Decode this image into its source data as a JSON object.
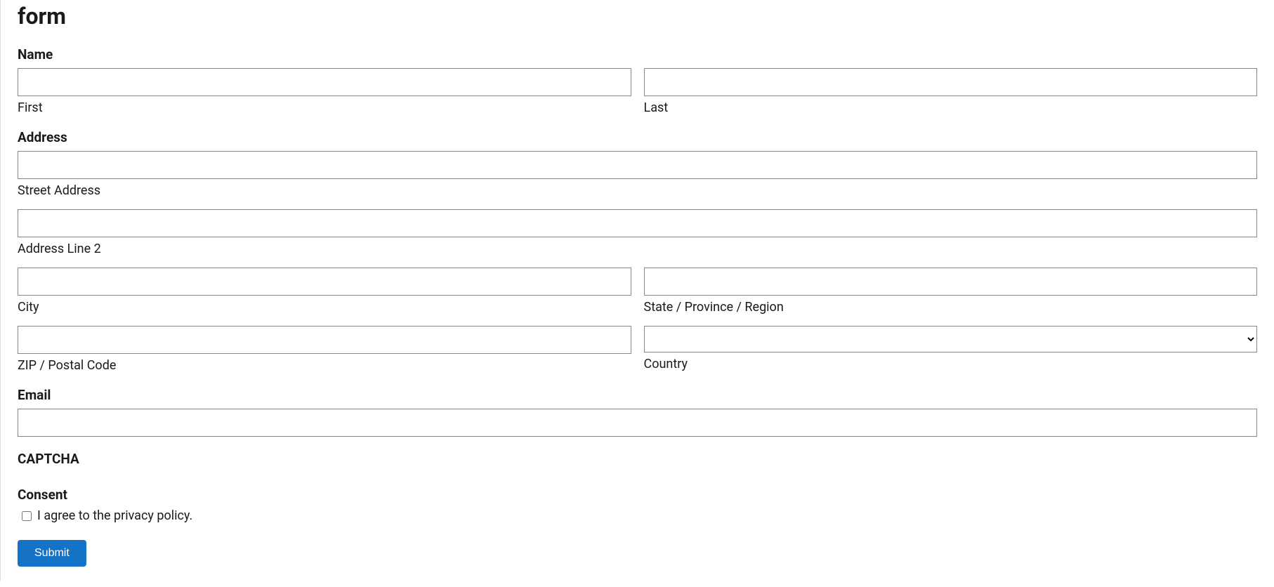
{
  "form": {
    "title": "form",
    "name": {
      "label": "Name",
      "first_sub": "First",
      "last_sub": "Last"
    },
    "address": {
      "label": "Address",
      "street_sub": "Street Address",
      "line2_sub": "Address Line 2",
      "city_sub": "City",
      "state_sub": "State / Province / Region",
      "zip_sub": "ZIP / Postal Code",
      "country_sub": "Country"
    },
    "email": {
      "label": "Email"
    },
    "captcha": {
      "label": "CAPTCHA"
    },
    "consent": {
      "label": "Consent",
      "text": "I agree to the privacy policy."
    },
    "submit": {
      "label": "Submit"
    }
  }
}
